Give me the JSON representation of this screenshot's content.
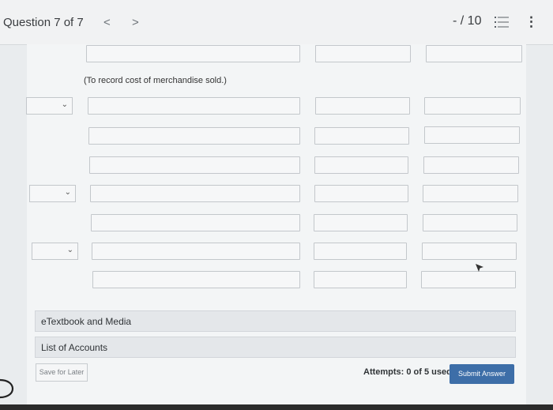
{
  "header": {
    "question_label": "Question 7 of 7",
    "prev_glyph": "<",
    "next_glyph": ">",
    "score": "- / 10",
    "list_icon": "list-icon",
    "more_icon": "more-vertical-icon",
    "more_glyph": "⋮"
  },
  "journal": {
    "note": "(To record cost of merchandise sold.)",
    "account_select_chevron": "⌄"
  },
  "panels": {
    "etextbook": "eTextbook and Media",
    "list_of_accounts": "List of Accounts"
  },
  "footer": {
    "save_label": "Save for Later",
    "attempts": "Attempts: 0 of 5 used",
    "submit_label": "Submit Answer"
  },
  "colors": {
    "accent": "#3d6ea8",
    "background": "#e9ecee",
    "field_border": "#c3c7cb"
  }
}
